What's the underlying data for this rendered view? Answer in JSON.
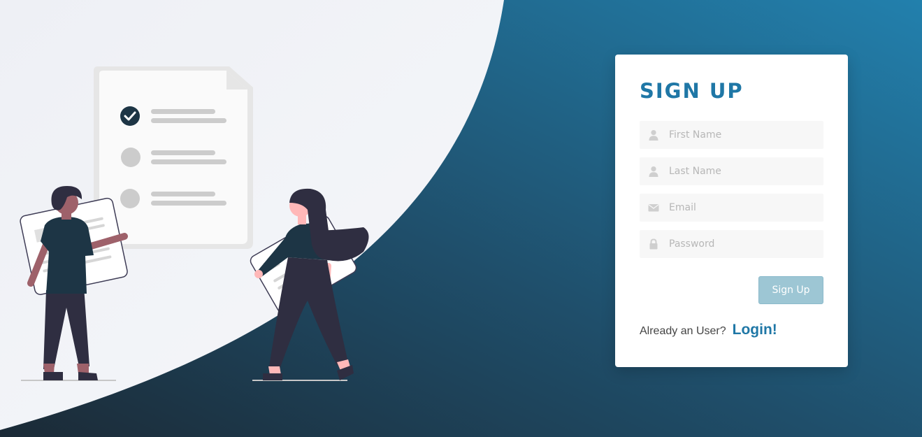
{
  "signup": {
    "title": "SIGN UP",
    "fields": [
      {
        "placeholder": "First Name",
        "icon": "user-icon",
        "type": "text"
      },
      {
        "placeholder": "Last Name",
        "icon": "user-icon",
        "type": "text"
      },
      {
        "placeholder": "Email",
        "icon": "envelope-icon",
        "type": "email"
      },
      {
        "placeholder": "Password",
        "icon": "lock-icon",
        "type": "password"
      }
    ],
    "submit_label": "Sign Up",
    "footer_question": "Already an User?",
    "login_link": "Login!"
  },
  "colors": {
    "accent": "#1f77a6",
    "button_bg": "#9dc6d4",
    "field_bg": "#f7f7f7",
    "background_dark": "#1d3545",
    "background_light": "#2280ad"
  }
}
